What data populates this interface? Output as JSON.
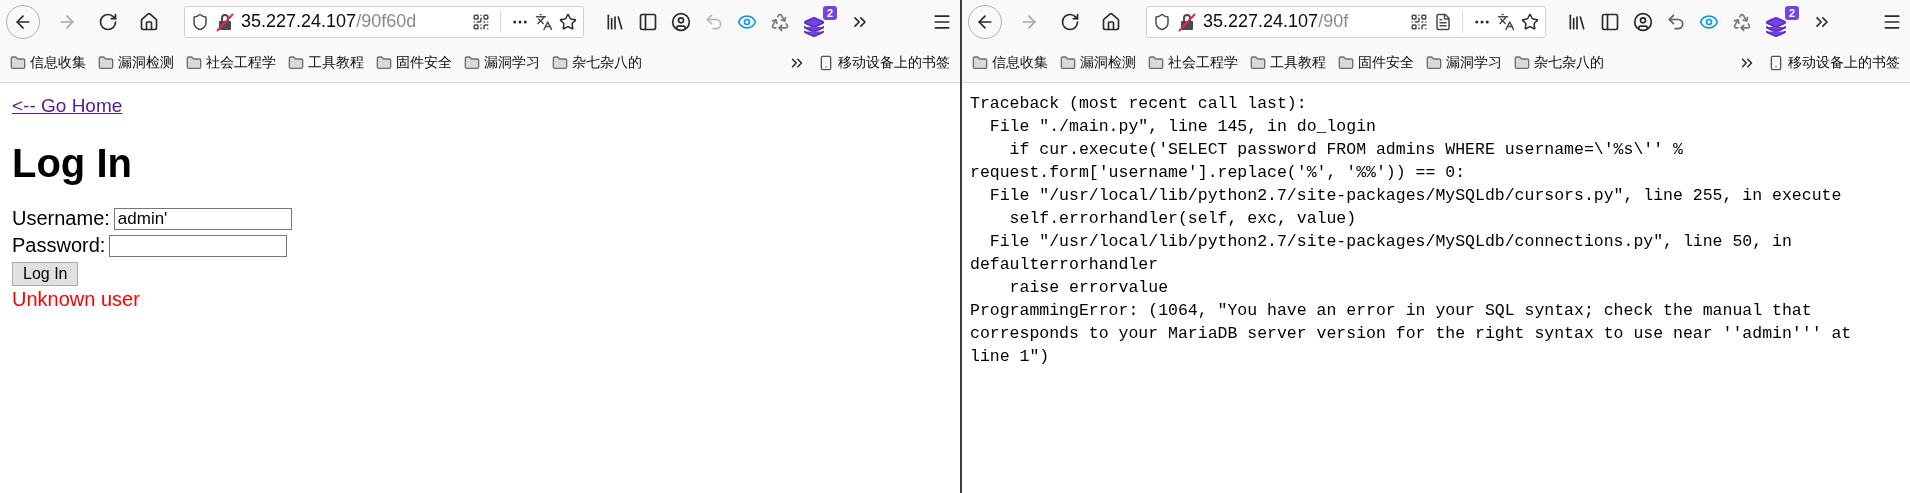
{
  "windows": [
    {
      "toolbar": {
        "url_host": "35.227.24.107",
        "url_path": "/90f60d",
        "reader_view": false,
        "undo_enabled": false,
        "extension_badge": "2"
      },
      "bookmarks": [
        {
          "label": "信息收集"
        },
        {
          "label": "漏洞检测"
        },
        {
          "label": "社会工程学"
        },
        {
          "label": "工具教程"
        },
        {
          "label": "固件安全"
        },
        {
          "label": "漏洞学习"
        },
        {
          "label": "杂七杂八的"
        }
      ],
      "mobile_bookmarks": "移动设备上的书签",
      "page": {
        "kind": "login",
        "link": "<-- Go Home",
        "heading": "Log In",
        "username_label": "Username:",
        "username_value": "admin'",
        "password_label": "Password:",
        "button": "Log In",
        "error": "Unknown user"
      }
    },
    {
      "toolbar": {
        "url_host": "35.227.24.107",
        "url_path": "/90f",
        "reader_view": true,
        "undo_enabled": true,
        "extension_badge": "2"
      },
      "bookmarks": [
        {
          "label": "信息收集"
        },
        {
          "label": "漏洞检测"
        },
        {
          "label": "社会工程学"
        },
        {
          "label": "工具教程"
        },
        {
          "label": "固件安全"
        },
        {
          "label": "漏洞学习"
        },
        {
          "label": "杂七杂八的"
        }
      ],
      "mobile_bookmarks": "移动设备上的书签",
      "page": {
        "kind": "traceback",
        "lines": [
          "Traceback (most recent call last):",
          "  File \"./main.py\", line 145, in do_login",
          "    if cur.execute('SELECT password FROM admins WHERE username=\\'%s\\'' %",
          "request.form['username'].replace('%', '%%')) == 0:",
          "  File \"/usr/local/lib/python2.7/site-packages/MySQLdb/cursors.py\", line 255, in execute",
          "    self.errorhandler(self, exc, value)",
          "  File \"/usr/local/lib/python2.7/site-packages/MySQLdb/connections.py\", line 50, in",
          "defaulterrorhandler",
          "    raise errorvalue",
          "ProgrammingError: (1064, \"You have an error in your SQL syntax; check the manual that",
          "corresponds to your MariaDB server version for the right syntax to use near ''admin''' at",
          "line 1\")"
        ]
      }
    }
  ]
}
